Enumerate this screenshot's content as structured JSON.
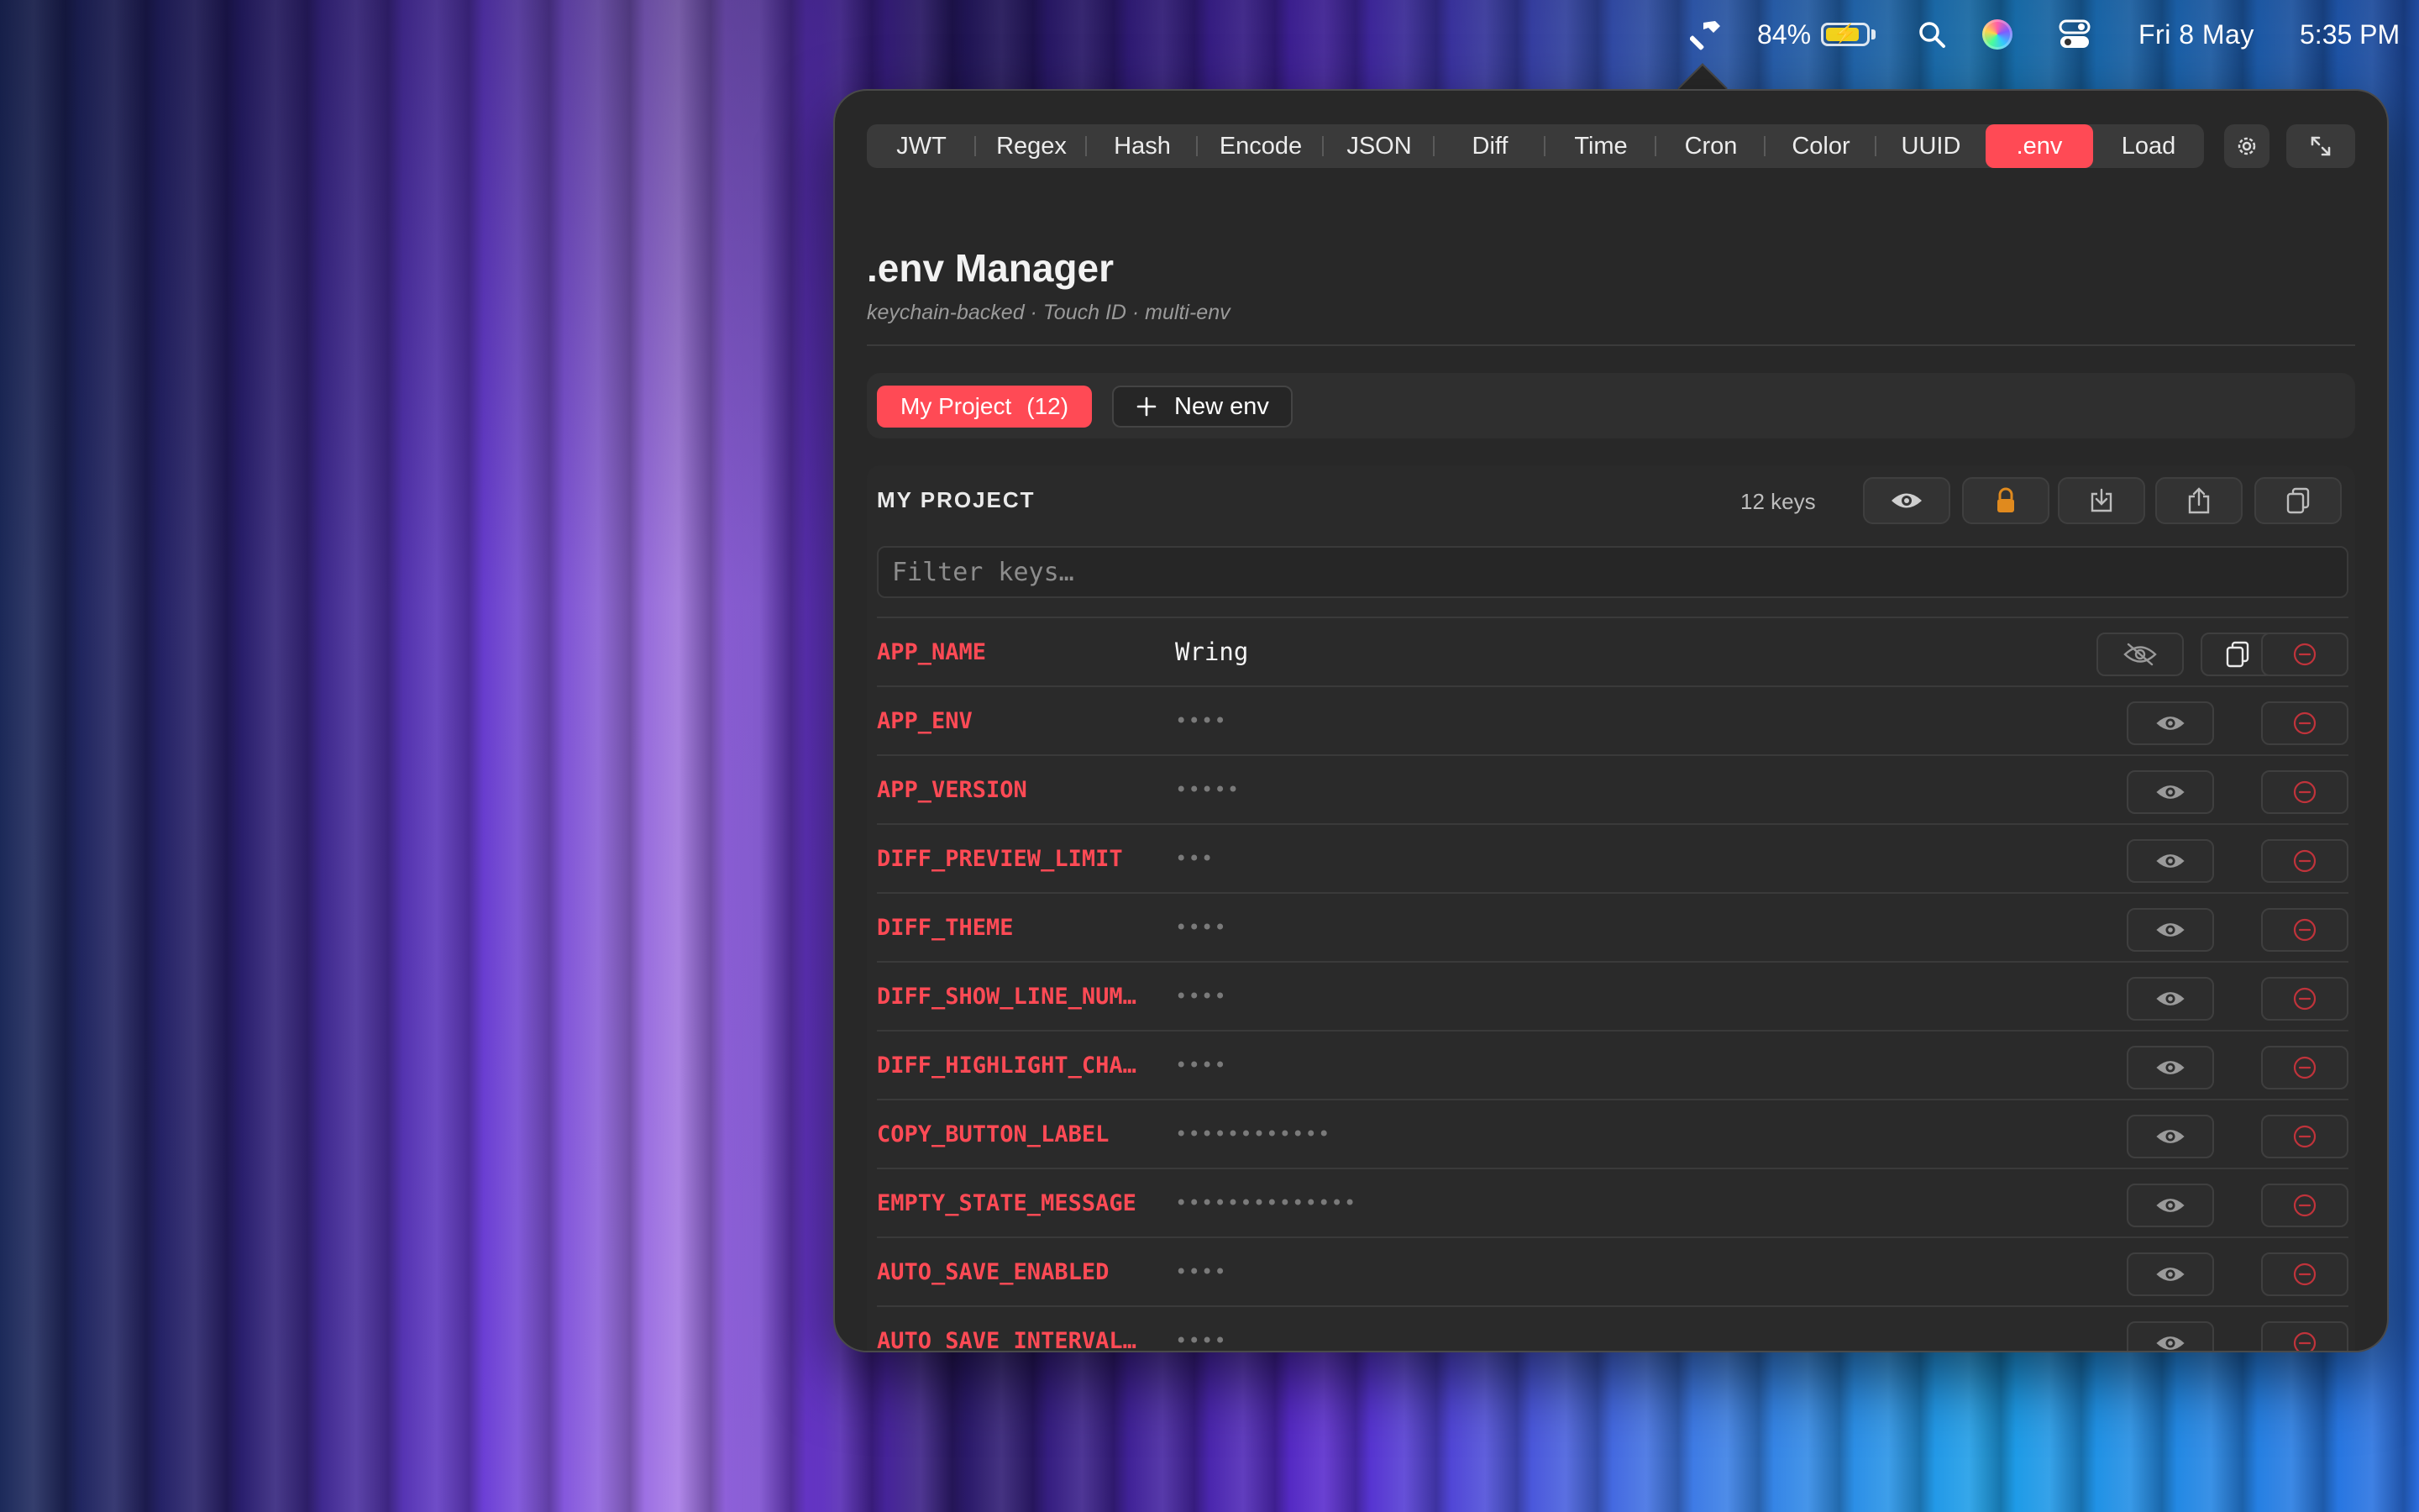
{
  "menubar": {
    "battery_percent": "84%",
    "battery_level": 0.84,
    "date": "Fri 8 May",
    "time": "5:35 PM",
    "icons": [
      "hammer-icon",
      "battery-icon",
      "search-icon",
      "siri-icon",
      "control-center-icon"
    ]
  },
  "tabs": [
    {
      "label": "JWT",
      "active": false
    },
    {
      "label": "Regex",
      "active": false
    },
    {
      "label": "Hash",
      "active": false
    },
    {
      "label": "Encode",
      "active": false
    },
    {
      "label": "JSON",
      "active": false
    },
    {
      "label": "Diff",
      "active": false
    },
    {
      "label": "Time",
      "active": false
    },
    {
      "label": "Cron",
      "active": false
    },
    {
      "label": "Color",
      "active": false
    },
    {
      "label": "UUID",
      "active": false
    },
    {
      "label": ".env",
      "active": true
    },
    {
      "label": "Load",
      "active": false
    }
  ],
  "header_icons": [
    "settings-icon",
    "expand-icon"
  ],
  "page": {
    "title": ".env Manager",
    "subtitle": "keychain-backed · Touch ID · multi-env"
  },
  "env_strip": {
    "active_env_name": "My Project",
    "active_env_count": "(12)",
    "new_env_label": "New env"
  },
  "project": {
    "name": "MY PROJECT",
    "key_count": "12 keys",
    "toolbar_icons": [
      "eye-icon",
      "lock-icon",
      "import-icon",
      "share-icon",
      "copy-all-icon"
    ],
    "filter_placeholder": "Filter keys…"
  },
  "rows": [
    {
      "key": "APP_NAME",
      "value": "Wring",
      "revealed": true
    },
    {
      "key": "APP_ENV",
      "value": "••••",
      "revealed": false
    },
    {
      "key": "APP_VERSION",
      "value": "•••••",
      "revealed": false
    },
    {
      "key": "DIFF_PREVIEW_LIMIT",
      "value": "•••",
      "revealed": false
    },
    {
      "key": "DIFF_THEME",
      "value": "••••",
      "revealed": false
    },
    {
      "key": "DIFF_SHOW_LINE_NUM…",
      "value": "••••",
      "revealed": false
    },
    {
      "key": "DIFF_HIGHLIGHT_CHA…",
      "value": "••••",
      "revealed": false
    },
    {
      "key": "COPY_BUTTON_LABEL",
      "value": "••••••••••••",
      "revealed": false
    },
    {
      "key": "EMPTY_STATE_MESSAGE",
      "value": "••••••••••••••",
      "revealed": false
    },
    {
      "key": "AUTO_SAVE_ENABLED",
      "value": "••••",
      "revealed": false
    },
    {
      "key": "AUTO_SAVE_INTERVAL…",
      "value": "••••",
      "revealed": false
    }
  ],
  "colors": {
    "accent": "#ff4a55",
    "panel": "#282828",
    "lock": "#e08a1e"
  }
}
